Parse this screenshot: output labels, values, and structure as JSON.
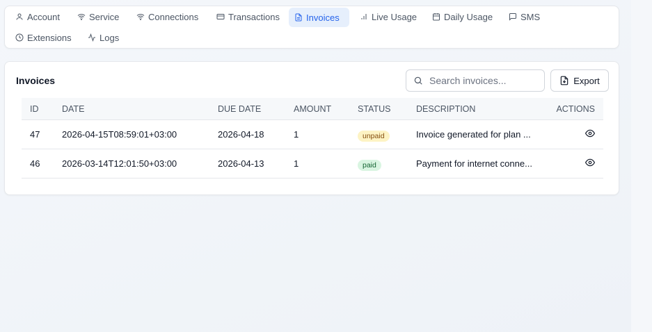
{
  "tabs": [
    {
      "label": "Account",
      "icon": "user-icon",
      "active": false
    },
    {
      "label": "Service",
      "icon": "wifi-icon",
      "active": false
    },
    {
      "label": "Connections",
      "icon": "wifi-icon",
      "active": false
    },
    {
      "label": "Transactions",
      "icon": "credit-card-icon",
      "active": false
    },
    {
      "label": "Invoices",
      "icon": "file-text-icon",
      "active": true
    },
    {
      "label": "Live Usage",
      "icon": "bar-chart-icon",
      "active": false
    },
    {
      "label": "Daily Usage",
      "icon": "calendar-icon",
      "active": false
    },
    {
      "label": "SMS",
      "icon": "message-icon",
      "active": false
    },
    {
      "label": "Extensions",
      "icon": "clock-icon",
      "active": false
    },
    {
      "label": "Logs",
      "icon": "activity-icon",
      "active": false
    }
  ],
  "invoices": {
    "title": "Invoices",
    "search_placeholder": "Search invoices...",
    "export_label": "Export",
    "columns": [
      "ID",
      "DATE",
      "DUE DATE",
      "AMOUNT",
      "STATUS",
      "DESCRIPTION",
      "ACTIONS"
    ],
    "rows": [
      {
        "id": "47",
        "date": "2026-04-15T08:59:01+03:00",
        "due_date": "2026-04-18",
        "amount": "1",
        "status": "unpaid",
        "description": "Invoice generated for plan ..."
      },
      {
        "id": "46",
        "date": "2026-03-14T12:01:50+03:00",
        "due_date": "2026-04-13",
        "amount": "1",
        "status": "paid",
        "description": "Payment for internet conne..."
      }
    ]
  },
  "colors": {
    "accent": "#2563eb",
    "active_tab_bg": "#e6effc",
    "unpaid_bg": "#fdf3c4",
    "paid_bg": "#d9f5e1"
  }
}
